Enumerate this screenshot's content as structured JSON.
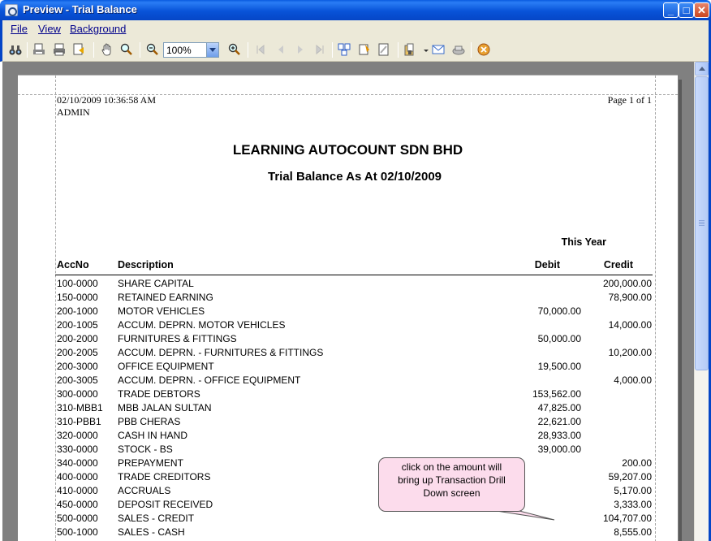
{
  "window": {
    "title": "Preview - Trial Balance"
  },
  "menu": [
    "File",
    "View",
    "Background"
  ],
  "toolbar": {
    "zoom": "100%"
  },
  "report": {
    "print_datetime": "02/10/2009 10:36:58 AM",
    "user": "ADMIN",
    "page_info": "Page 1 of 1",
    "company": "LEARNING AUTOCOUNT SDN BHD",
    "subtitle": "Trial Balance As At 02/10/2009",
    "period_header": "This Year",
    "columns": {
      "accno": "AccNo",
      "description": "Description",
      "debit": "Debit",
      "credit": "Credit"
    },
    "rows": [
      {
        "accno": "100-0000",
        "description": "SHARE CAPITAL",
        "debit": "",
        "credit": "200,000.00"
      },
      {
        "accno": "150-0000",
        "description": "RETAINED EARNING",
        "debit": "",
        "credit": "78,900.00"
      },
      {
        "accno": "200-1000",
        "description": "MOTOR VEHICLES",
        "debit": "70,000.00",
        "credit": ""
      },
      {
        "accno": "200-1005",
        "description": "ACCUM. DEPRN. MOTOR VEHICLES",
        "debit": "",
        "credit": "14,000.00"
      },
      {
        "accno": "200-2000",
        "description": "FURNITURES & FITTINGS",
        "debit": "50,000.00",
        "credit": ""
      },
      {
        "accno": "200-2005",
        "description": "ACCUM. DEPRN. - FURNITURES & FITTINGS",
        "debit": "",
        "credit": "10,200.00"
      },
      {
        "accno": "200-3000",
        "description": "OFFICE EQUIPMENT",
        "debit": "19,500.00",
        "credit": ""
      },
      {
        "accno": "200-3005",
        "description": "ACCUM. DEPRN. - OFFICE EQUIPMENT",
        "debit": "",
        "credit": "4,000.00"
      },
      {
        "accno": "300-0000",
        "description": "TRADE DEBTORS",
        "debit": "153,562.00",
        "credit": ""
      },
      {
        "accno": "310-MBB1",
        "description": "MBB JALAN SULTAN",
        "debit": "47,825.00",
        "credit": ""
      },
      {
        "accno": "310-PBB1",
        "description": "PBB CHERAS",
        "debit": "22,621.00",
        "credit": ""
      },
      {
        "accno": "320-0000",
        "description": "CASH IN HAND",
        "debit": "28,933.00",
        "credit": ""
      },
      {
        "accno": "330-0000",
        "description": "STOCK - BS",
        "debit": "39,000.00",
        "credit": ""
      },
      {
        "accno": "340-0000",
        "description": "PREPAYMENT",
        "debit": "",
        "credit": "200.00"
      },
      {
        "accno": "400-0000",
        "description": "TRADE CREDITORS",
        "debit": "",
        "credit": "59,207.00"
      },
      {
        "accno": "410-0000",
        "description": "ACCRUALS",
        "debit": "",
        "credit": "5,170.00"
      },
      {
        "accno": "450-0000",
        "description": "DEPOSIT RECEIVED",
        "debit": "",
        "credit": "3,333.00"
      },
      {
        "accno": "500-0000",
        "description": "SALES - CREDIT",
        "debit": "",
        "credit": "104,707.00"
      },
      {
        "accno": "500-1000",
        "description": "SALES - CASH",
        "debit": "",
        "credit": "8,555.00"
      }
    ]
  },
  "callout": {
    "lines": [
      "click on the amount will",
      "bring up Transaction Drill",
      "Down screen"
    ]
  },
  "icons": [
    "binoculars-icon",
    "page-setup-icon",
    "print-icon",
    "quick-print-icon",
    "hand-tool-icon",
    "magnifier-icon",
    "zoom-out-icon",
    "zoom-in-icon",
    "first-page-icon",
    "previous-page-icon",
    "next-page-icon",
    "last-page-icon",
    "multiple-pages-icon",
    "color-icon",
    "watermark-icon",
    "export-icon",
    "email-icon",
    "send-icon",
    "close-preview-icon"
  ]
}
